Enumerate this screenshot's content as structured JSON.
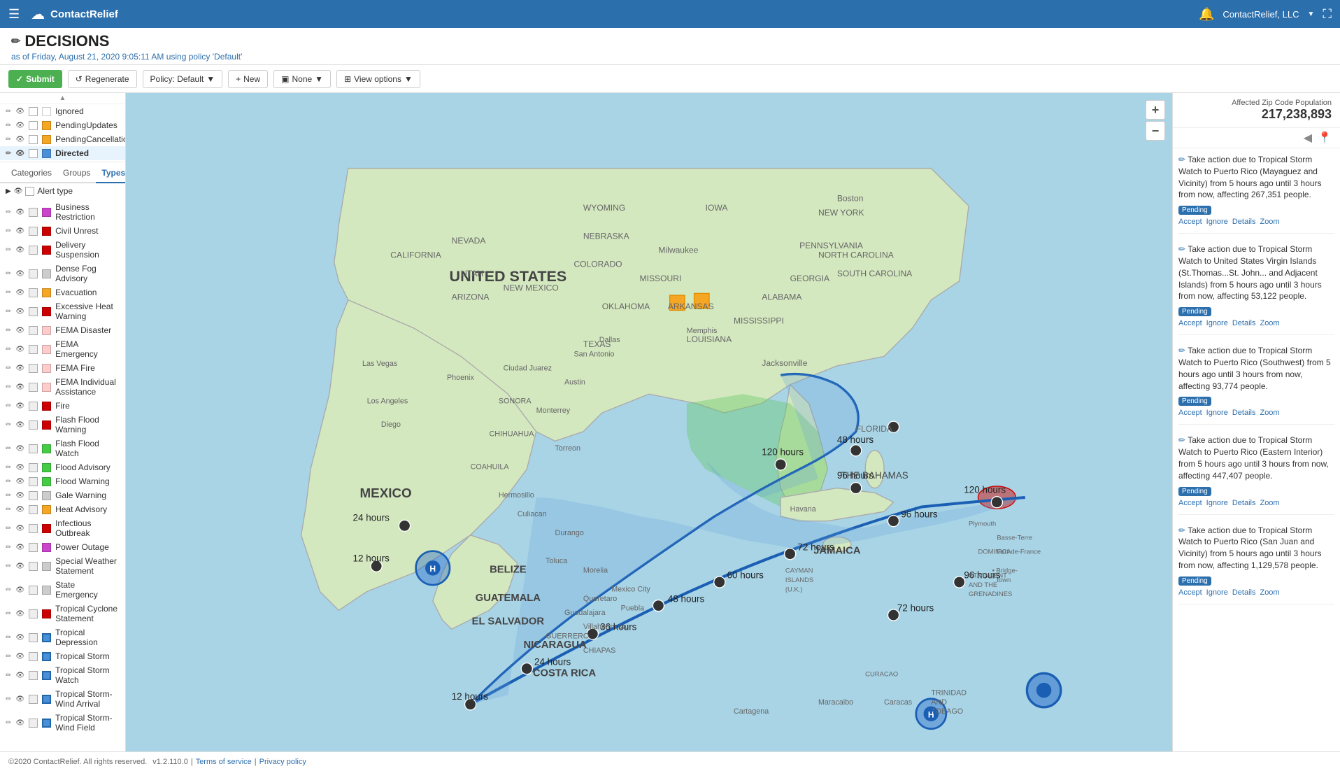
{
  "header": {
    "app_icon": "☁",
    "app_name": "ContactRelief",
    "company": "ContactRelief, LLC",
    "hamburger": "☰",
    "fullscreen_icon": "⛶"
  },
  "title": {
    "heading": "DECISIONS",
    "subtitle_prefix": "as of",
    "subtitle_date": "Friday, August 21, 2020 9:05:11 AM",
    "subtitle_policy_prefix": "using policy",
    "subtitle_policy": "'Default'"
  },
  "toolbar": {
    "submit_label": "Submit",
    "regenerate_label": "Regenerate",
    "policy_label": "Policy: Default",
    "new_label": "New",
    "none_label": "None",
    "view_options_label": "View options"
  },
  "affected": {
    "title": "Affected Zip Code Population",
    "count": "217,238,893"
  },
  "sidebar": {
    "tabs": [
      "Categories",
      "Groups",
      "Types"
    ],
    "active_tab": "Types",
    "status_items": [
      {
        "label": "Ignored",
        "color": "#ffffff",
        "checked": false
      },
      {
        "label": "PendingUpdates",
        "color": "#f5a623",
        "checked": false
      },
      {
        "label": "PendingCancellation",
        "color": "#f5a623",
        "checked": false
      },
      {
        "label": "Directed",
        "color": "#4a90d9",
        "checked": false,
        "highlight": true
      }
    ],
    "section_label": "Alert type",
    "alert_types": [
      {
        "label": "Business Restriction",
        "color": "#cc44cc",
        "checked": true
      },
      {
        "label": "Civil Unrest",
        "color": "#cc0000",
        "checked": true
      },
      {
        "label": "Delivery Suspension",
        "color": "#cc0000",
        "checked": true
      },
      {
        "label": "Dense Fog Advisory",
        "color": "#cccccc",
        "checked": true
      },
      {
        "label": "Evacuation",
        "color": "#f5a623",
        "checked": true
      },
      {
        "label": "Excessive Heat Warning",
        "color": "#cc0000",
        "checked": true
      },
      {
        "label": "FEMA Disaster",
        "color": "#ffcccc",
        "checked": true
      },
      {
        "label": "FEMA Emergency",
        "color": "#ffcccc",
        "checked": true
      },
      {
        "label": "FEMA Fire",
        "color": "#ffcccc",
        "checked": true
      },
      {
        "label": "FEMA Individual Assistance",
        "color": "#ffcccc",
        "checked": true
      },
      {
        "label": "Fire",
        "color": "#cc0000",
        "checked": true
      },
      {
        "label": "Flash Flood Warning",
        "color": "#cc0000",
        "checked": true
      },
      {
        "label": "Flash Flood Watch",
        "color": "#44cc44",
        "checked": true
      },
      {
        "label": "Flood Advisory",
        "color": "#44cc44",
        "checked": true
      },
      {
        "label": "Flood Warning",
        "color": "#44cc44",
        "checked": true
      },
      {
        "label": "Gale Warning",
        "color": "#cccccc",
        "checked": true
      },
      {
        "label": "Heat Advisory",
        "color": "#f5a623",
        "checked": true
      },
      {
        "label": "Infectious Outbreak",
        "color": "#cc0000",
        "checked": true
      },
      {
        "label": "Power Outage",
        "color": "#cc44cc",
        "checked": true
      },
      {
        "label": "Special Weather Statement",
        "color": "#cccccc",
        "checked": true
      },
      {
        "label": "State Emergency",
        "color": "#cccccc",
        "checked": true
      },
      {
        "label": "Tropical Cyclone Statement",
        "color": "#cc0000",
        "checked": true
      },
      {
        "label": "Tropical Depression",
        "color": "#4a90d9",
        "checked": true
      },
      {
        "label": "Tropical Storm",
        "color": "#4a90d9",
        "checked": true
      },
      {
        "label": "Tropical Storm Watch",
        "color": "#4a90d9",
        "checked": true
      },
      {
        "label": "Tropical Storm-Wind Arrival",
        "color": "#4a90d9",
        "checked": true
      },
      {
        "label": "Tropical Storm-Wind Field",
        "color": "#4a90d9",
        "checked": true
      }
    ]
  },
  "alerts": [
    {
      "text": "Take action due to Tropical Storm Watch to Puerto Rico (Mayaguez and Vicinity) from 5 hours ago until 3 hours from now, affecting 267,351 people.",
      "status": "Pending",
      "actions": [
        "Accept",
        "Ignore",
        "Details",
        "Zoom"
      ]
    },
    {
      "text": "Take action due to Tropical Storm Watch to United States Virgin Islands (St.Thomas...St. John... and Adjacent Islands) from 5 hours ago until 3 hours from now, affecting 53,122 people.",
      "status": "Pending",
      "actions": [
        "Accept",
        "Ignore",
        "Details",
        "Zoom"
      ]
    },
    {
      "text": "Take action due to Tropical Storm Watch to Puerto Rico (Southwest) from 5 hours ago until 3 hours from now, affecting 93,774 people.",
      "status": "Pending",
      "actions": [
        "Accept",
        "Ignore",
        "Details",
        "Zoom"
      ]
    },
    {
      "text": "Take action due to Tropical Storm Watch to Puerto Rico (Eastern Interior) from 5 hours ago until 3 hours from now, affecting 447,407 people.",
      "status": "Pending",
      "actions": [
        "Accept",
        "Ignore",
        "Details",
        "Zoom"
      ]
    },
    {
      "text": "Take action due to Tropical Storm Watch to Puerto Rico (San Juan and Vicinity) from 5 hours ago until 3 hours from now, affecting 1,129,578 people.",
      "status": "Pending",
      "actions": [
        "Accept",
        "Ignore",
        "Details",
        "Zoom"
      ]
    }
  ],
  "footer": {
    "copyright": "©2020 ContactRelief. All rights reserved.",
    "version": "v1.2.110.0",
    "terms": "Terms of service",
    "privacy": "Privacy policy"
  },
  "map": {
    "storm_path_label_12h": "12 hours",
    "storm_path_label_24h": "24 hours",
    "storm_path_label_36h": "36 hours",
    "storm_path_label_48h": "48 hours",
    "storm_path_label_60h": "60 hours",
    "storm_path_label_72h": "72 hours",
    "storm_path_label_96h": "96 hours",
    "storm_path_label_120h": "120 hours",
    "zoom_in": "+",
    "zoom_out": "−"
  }
}
